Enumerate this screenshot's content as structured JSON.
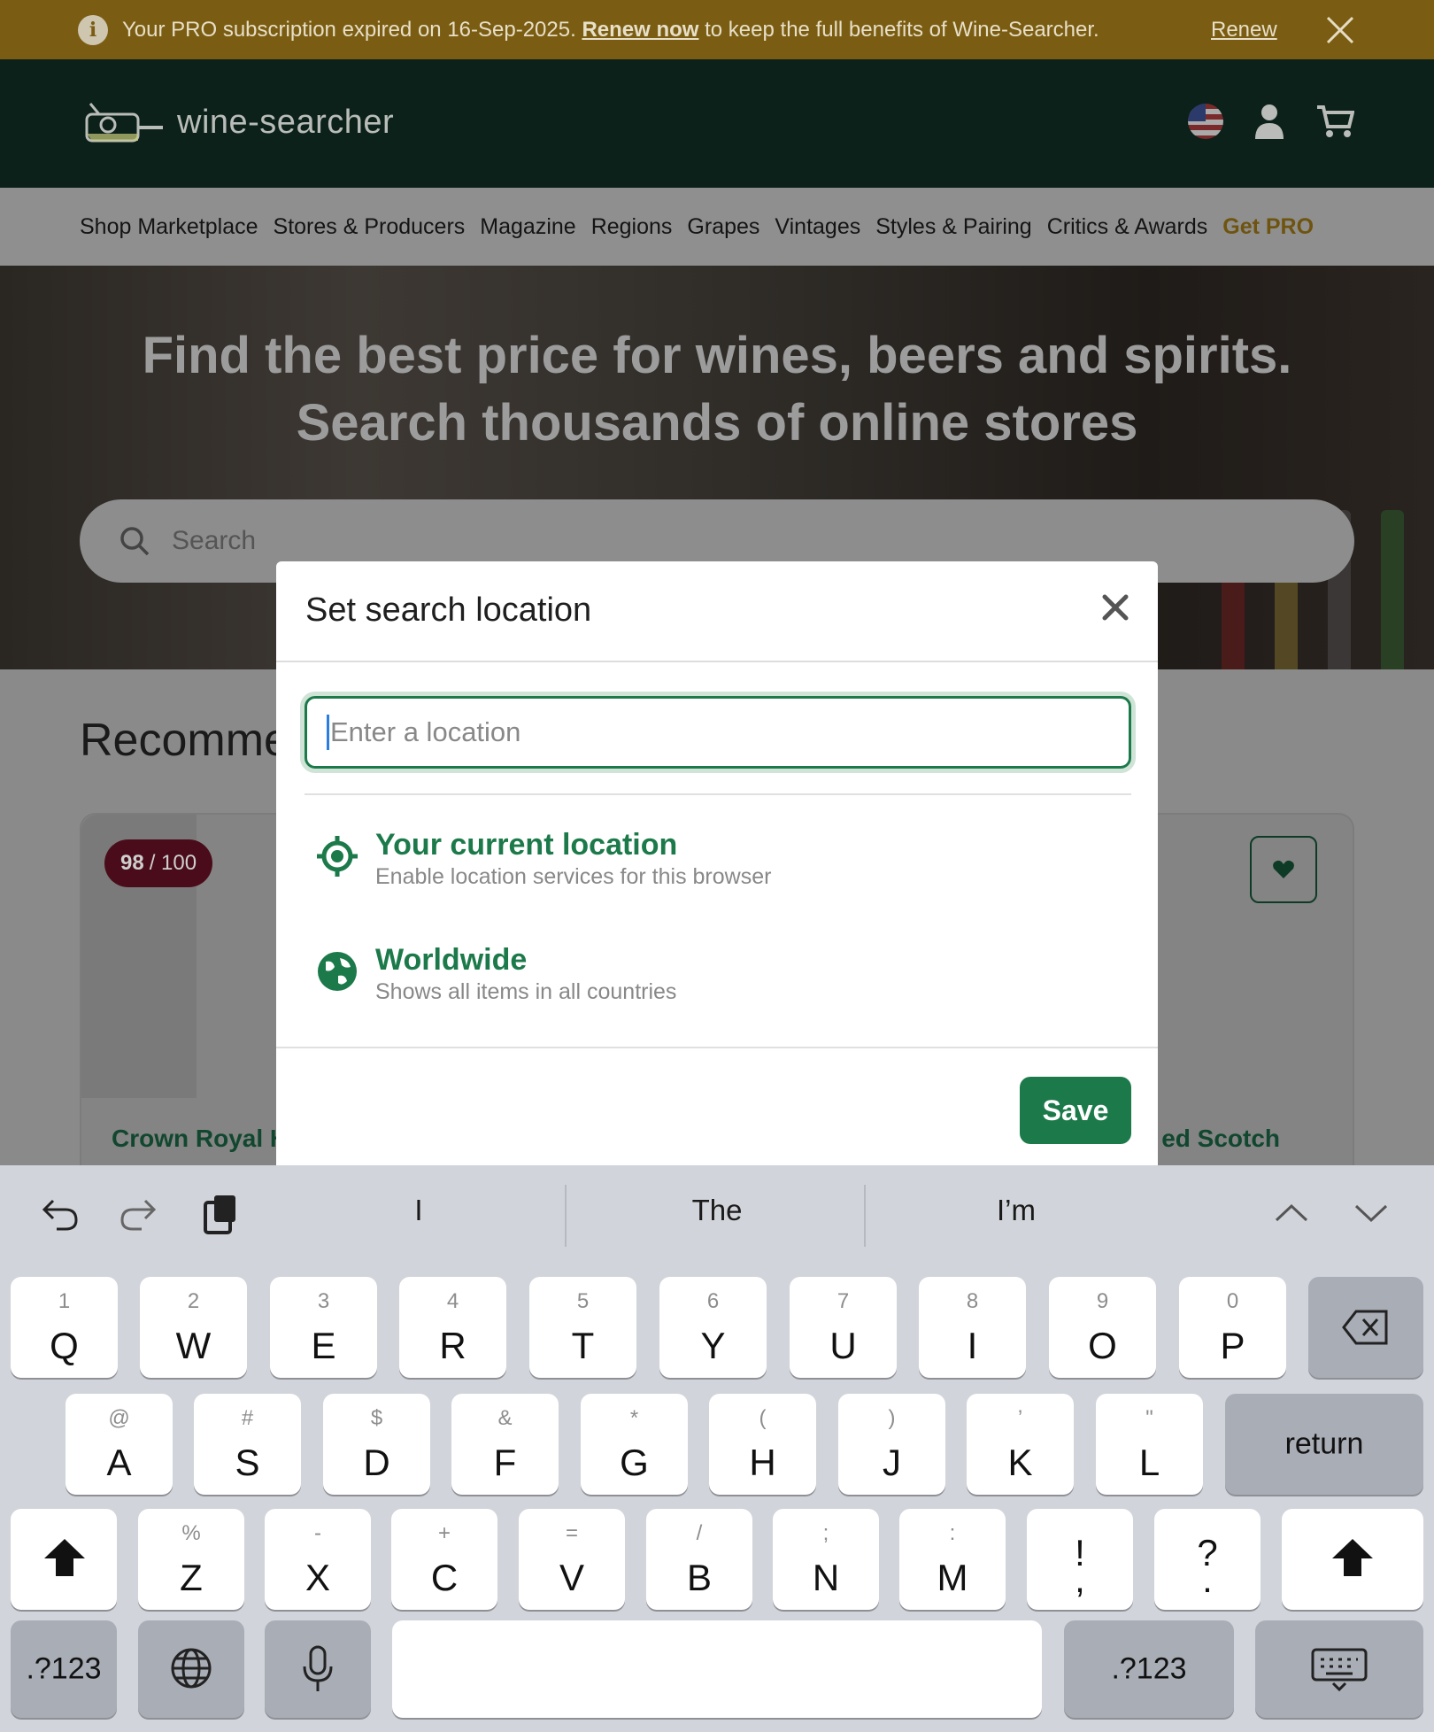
{
  "banner": {
    "message": "Your PRO subscription expired on 16-Sep-2025.",
    "link": "Renew now",
    "message_end": "to keep the full benefits of Wine-Searcher.",
    "renew": "Renew"
  },
  "header": {
    "brand": "wine-searcher"
  },
  "nav": {
    "items": [
      "Shop Marketplace",
      "Stores & Producers",
      "Magazine",
      "Regions",
      "Grapes",
      "Vintages",
      "Styles & Pairing",
      "Critics & Awards"
    ],
    "pro": "Get PRO"
  },
  "hero": {
    "line1": "Find the best price for wines, beers and spirits.",
    "line2": "Search thousands of online stores",
    "search_placeholder": "Search"
  },
  "content": {
    "heading": "Recommended",
    "score_value": "98",
    "score_total": "/ 100",
    "card_title_left": "Crown Royal H",
    "card_title_right": "ed Scotch"
  },
  "modal": {
    "title": "Set search location",
    "input_placeholder": "Enter a location",
    "options": [
      {
        "label": "Your current location",
        "sub": "Enable location services for this browser"
      },
      {
        "label": "Worldwide",
        "sub": "Shows all items in all countries"
      }
    ],
    "save": "Save"
  },
  "keyboard": {
    "suggestions": [
      "I",
      "The",
      "I’m"
    ],
    "row1": [
      [
        "1",
        "Q"
      ],
      [
        "2",
        "W"
      ],
      [
        "3",
        "E"
      ],
      [
        "4",
        "R"
      ],
      [
        "5",
        "T"
      ],
      [
        "6",
        "Y"
      ],
      [
        "7",
        "U"
      ],
      [
        "8",
        "I"
      ],
      [
        "9",
        "O"
      ],
      [
        "0",
        "P"
      ]
    ],
    "row2": [
      [
        "@",
        "A"
      ],
      [
        "#",
        "S"
      ],
      [
        "$",
        "D"
      ],
      [
        "&",
        "F"
      ],
      [
        "*",
        "G"
      ],
      [
        "(",
        "H"
      ],
      [
        ")",
        "J"
      ],
      [
        "’",
        "K"
      ],
      [
        "\"",
        "L"
      ]
    ],
    "row3": [
      [
        "%",
        "Z"
      ],
      [
        "-",
        "X"
      ],
      [
        "+",
        "C"
      ],
      [
        "=",
        "V"
      ],
      [
        "/",
        "B"
      ],
      [
        ";",
        "N"
      ],
      [
        ":",
        "M"
      ],
      [
        "!",
        ","
      ],
      [
        "?",
        "."
      ]
    ],
    "return": "return",
    "numbers": ".?123"
  },
  "colors": {
    "accent": "#1c7a4a",
    "banner": "#7a5d12",
    "header": "#0b2119"
  }
}
